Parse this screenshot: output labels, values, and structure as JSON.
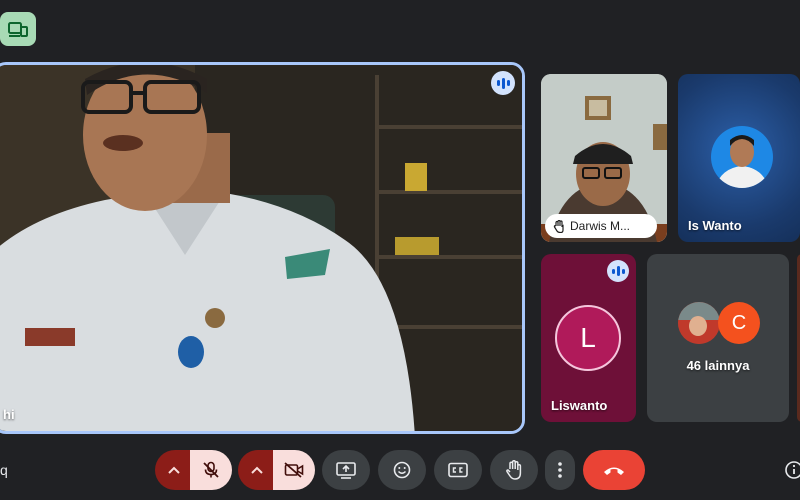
{
  "main_speaker": {
    "name_partial": "hi"
  },
  "participants": [
    {
      "name": "Darwis M...",
      "hand_raised": true
    },
    {
      "name": "Is Wanto"
    },
    {
      "name": "Liswanto",
      "initial": "L",
      "speaking": true
    },
    {
      "others_label": "46 lainnya",
      "avatar_initial": "C"
    }
  ],
  "bottom_left_partial": "q",
  "colors": {
    "accent_border": "#a8c7fa",
    "end_call": "#ea4335",
    "muted_bg": "#8c1d18",
    "muted_icon_bg": "#f9dedc"
  },
  "icons": [
    "device-switch-icon",
    "chevron-up-icon",
    "mic-off-icon",
    "camera-off-icon",
    "present-screen-icon",
    "emoji-icon",
    "captions-icon",
    "raise-hand-icon",
    "more-options-icon",
    "end-call-icon",
    "info-icon",
    "speaking-indicator-icon"
  ]
}
